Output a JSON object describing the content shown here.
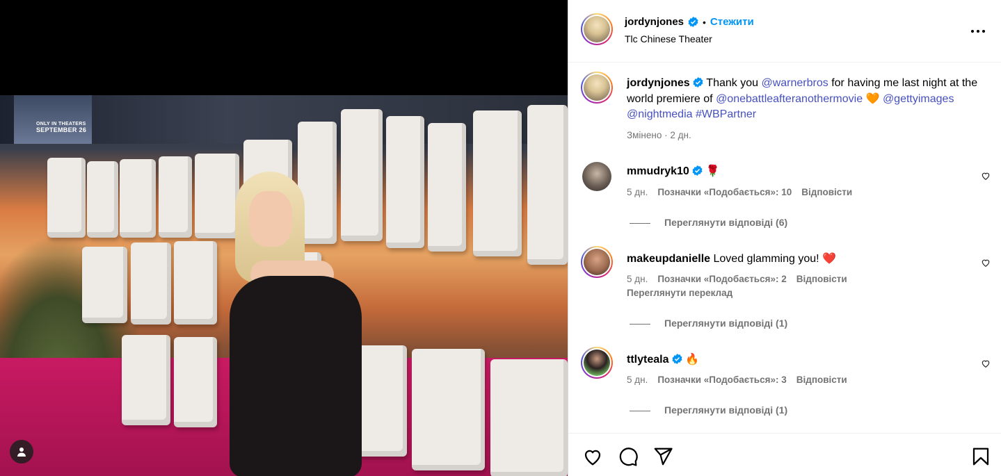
{
  "post": {
    "author": "jordynjones",
    "follow_label": "Стежити",
    "location": "Tlc Chinese Theater",
    "dot": "•",
    "poster_line1": "ONLY IN THEATERS",
    "poster_line2": "SEPTEMBER 26",
    "caption_prefix": "Thank you",
    "caption_mention1": "@warnerbros",
    "caption_mid": "for having me last night at the world premiere of",
    "caption_mention2": "@onebattleafteranothermovie",
    "caption_emoji": "🧡",
    "caption_mention3": "@gettyimages",
    "caption_mention4": "@nightmedia",
    "caption_hashtag": "#WBPartner",
    "edited_time": "Змінено · 2 дн."
  },
  "comments": [
    {
      "user": "mmudryk10",
      "verified": true,
      "text": "🌹",
      "time": "5 дн.",
      "likes": "Позначки «Подобається»: 10",
      "reply": "Відповісти",
      "translate": "",
      "view_replies": "Переглянути відповіді (6)"
    },
    {
      "user": "makeupdanielle",
      "verified": false,
      "text": "Loved glamming you! ❤️",
      "time": "5 дн.",
      "likes": "Позначки «Подобається»: 2",
      "reply": "Відповісти",
      "translate": "Переглянути переклад",
      "view_replies": "Переглянути відповіді (1)"
    },
    {
      "user": "ttlyteala",
      "verified": true,
      "text": "🔥",
      "time": "5 дн.",
      "likes": "Позначки «Подобається»: 3",
      "reply": "Відповісти",
      "translate": "",
      "view_replies": "Переглянути відповіді (1)"
    }
  ],
  "icons": {
    "verified": "verified-badge-icon",
    "more": "more-options-icon",
    "like": "heart-icon",
    "comment": "comment-icon",
    "share": "share-icon",
    "save": "bookmark-icon",
    "tagged": "user-tag-icon"
  },
  "colors": {
    "link": "#0095f6",
    "mention": "#4650c0",
    "muted": "#737373",
    "verified": "#0095f6"
  }
}
